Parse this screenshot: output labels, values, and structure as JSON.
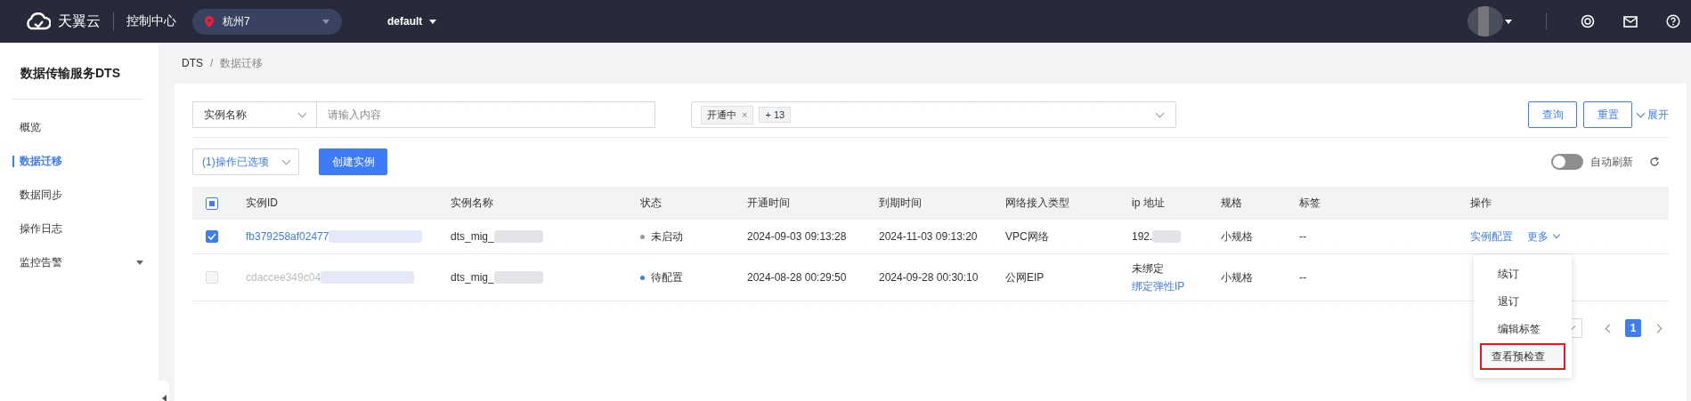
{
  "topbar": {
    "brand": "天翼云",
    "console": "控制中心",
    "region": "杭州7",
    "project": "default"
  },
  "sidebar": {
    "title": "数据传输服务DTS",
    "items": [
      {
        "label": "概览",
        "selected": false,
        "has_submenu": false
      },
      {
        "label": "数据迁移",
        "selected": true,
        "has_submenu": false
      },
      {
        "label": "数据同步",
        "selected": false,
        "has_submenu": false
      },
      {
        "label": "操作日志",
        "selected": false,
        "has_submenu": false
      },
      {
        "label": "监控告警",
        "selected": false,
        "has_submenu": true
      }
    ]
  },
  "breadcrumb": [
    "DTS",
    "数据迁移"
  ],
  "breadcrumb_separator": "/",
  "filters": {
    "remove_icon": "×",
    "field": "实例名称",
    "search_placeholder": "请输入内容",
    "status_tags": [
      {
        "label": "开通中",
        "removable": true
      },
      {
        "label": "+ 13",
        "removable": false
      }
    ],
    "buttons": [
      "查询",
      "重置"
    ],
    "expand": "展开"
  },
  "toolbar": {
    "batch_select": "(1)操作已选项",
    "create": "创建实例",
    "auto_refresh": {
      "label": "自动刷新",
      "on": false
    }
  },
  "table": {
    "header_checkbox": {
      "indeterminate": true
    },
    "columns": [
      "实例ID",
      "实例名称",
      "状态",
      "开通时间",
      "到期时间",
      "网络接入类型",
      "ip 地址",
      "规格",
      "标签",
      "操作"
    ],
    "rows": [
      {
        "checked": true,
        "disabled": false,
        "id": "fb379258af02477",
        "name": "dts_mig_",
        "status": {
          "label": "未启动",
          "color": "#999999"
        },
        "opened": "2024-09-03 09:13:28",
        "expires": "2024-11-03 09:13:20",
        "network": "VPC网络",
        "ip": {
          "text": "192."
        },
        "spec": "小规格",
        "tags": "--",
        "actions": [
          "实例配置",
          "更多"
        ]
      },
      {
        "checked": false,
        "disabled": true,
        "id": "cdaccee349c04",
        "name": "dts_mig_",
        "status": {
          "label": "待配置",
          "color": "#3d7bf7"
        },
        "opened": "2024-08-28 00:29:50",
        "expires": "2024-09-28 00:30:10",
        "network": "公网EIP",
        "ip": {
          "text": "未绑定",
          "link": "绑定弹性IP"
        },
        "spec": "小规格",
        "tags": "--",
        "actions": []
      }
    ]
  },
  "dropdown_menu": {
    "items": [
      {
        "label": "续订",
        "highlighted": false
      },
      {
        "label": "退订",
        "highlighted": false
      },
      {
        "label": "编辑标签",
        "highlighted": false
      },
      {
        "label": "查看预检查",
        "highlighted": true
      }
    ]
  },
  "pagination": {
    "pages": [
      {
        "label": "1",
        "selected": true
      }
    ]
  }
}
